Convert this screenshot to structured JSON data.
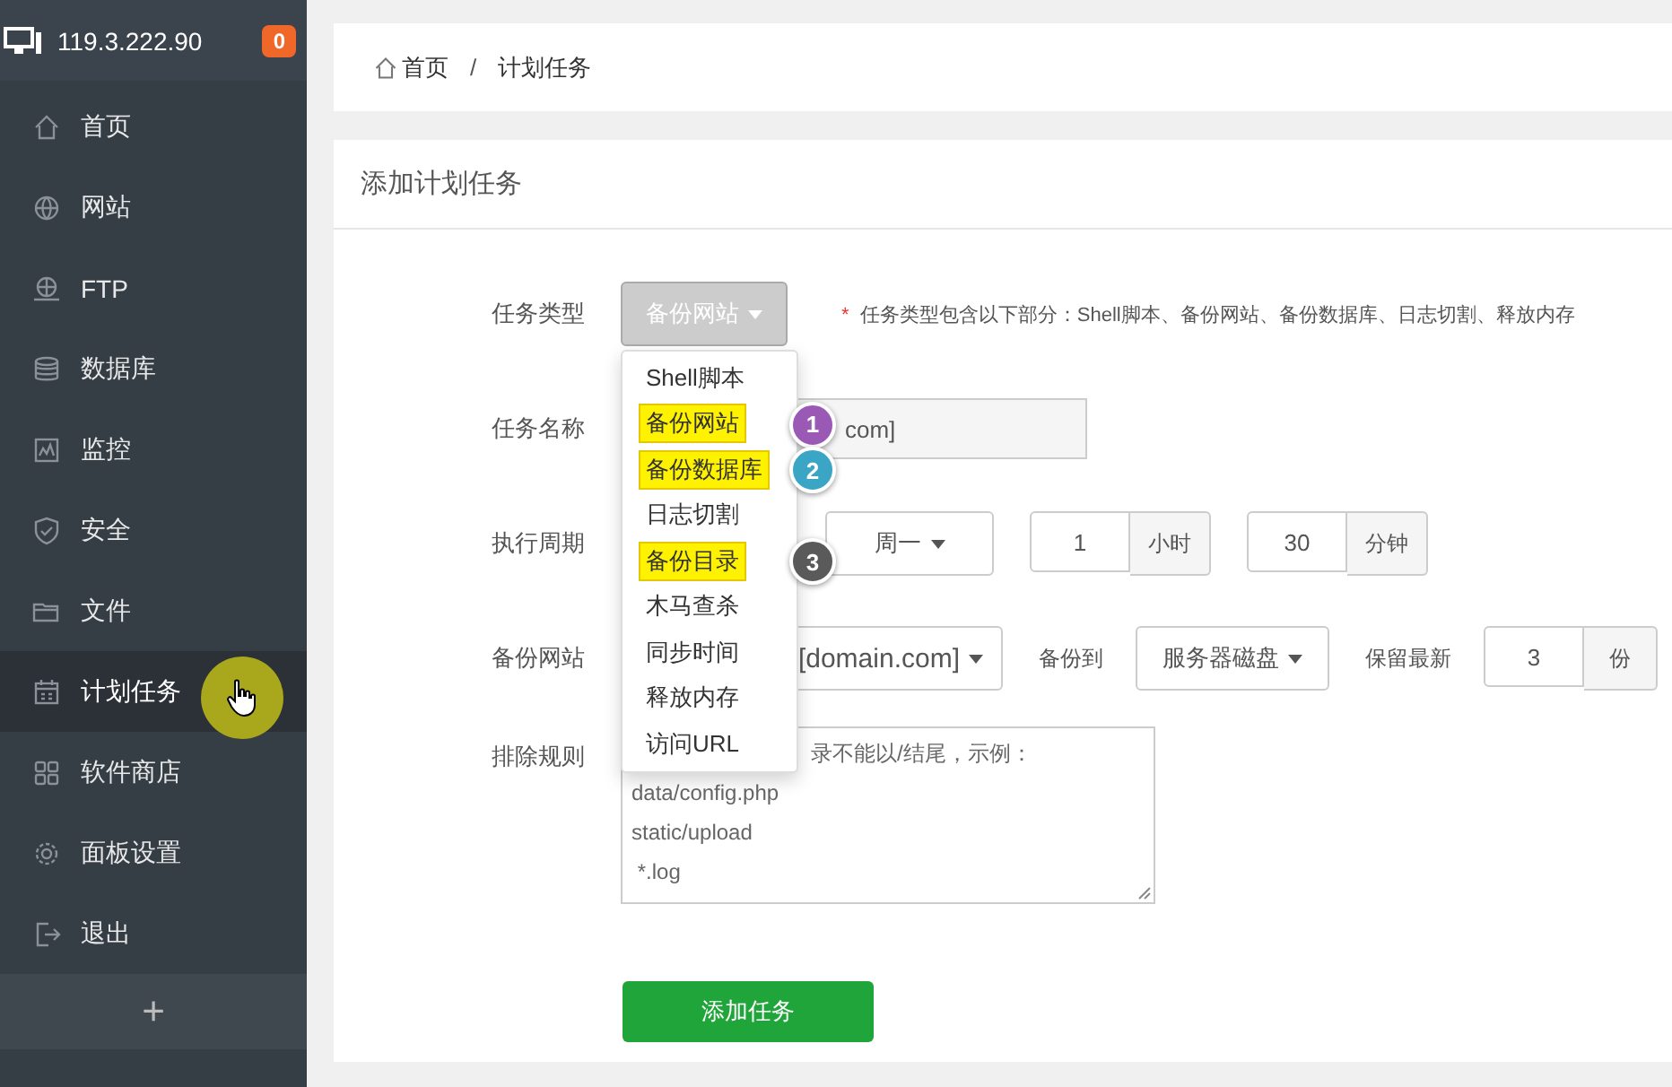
{
  "sidebar": {
    "host": "119.3.222.90",
    "badge": "0",
    "items": [
      {
        "label": "首页",
        "selected": false
      },
      {
        "label": "网站",
        "selected": false
      },
      {
        "label": "FTP",
        "selected": false
      },
      {
        "label": "数据库",
        "selected": false
      },
      {
        "label": "监控",
        "selected": false
      },
      {
        "label": "安全",
        "selected": false
      },
      {
        "label": "文件",
        "selected": false
      },
      {
        "label": "计划任务",
        "selected": true
      },
      {
        "label": "软件商店",
        "selected": false
      },
      {
        "label": "面板设置",
        "selected": false
      },
      {
        "label": "退出",
        "selected": false
      }
    ],
    "add_button": "+"
  },
  "breadcrumb": {
    "items": [
      "首页",
      "计划任务"
    ],
    "separator": "/"
  },
  "panel": {
    "title": "添加计划任务",
    "task_type": {
      "label": "任务类型",
      "value": "备份网站",
      "expanded": true,
      "note_mark": "*",
      "note": "任务类型包含以下部分：Shell脚本、备份网站、备份数据库、日志切割、释放内存",
      "options": [
        {
          "label": "Shell脚本",
          "highlighted": false
        },
        {
          "label": "备份网站",
          "highlighted": true,
          "step": "1",
          "color": "#9b59b6"
        },
        {
          "label": "备份数据库",
          "highlighted": true,
          "step": "2",
          "color": "#3ba5c5"
        },
        {
          "label": "日志切割",
          "highlighted": false
        },
        {
          "label": "备份目录",
          "highlighted": true,
          "step": "3",
          "color": "#5a5a5a"
        },
        {
          "label": "木马查杀",
          "highlighted": false
        },
        {
          "label": "同步时间",
          "highlighted": false
        },
        {
          "label": "释放内存",
          "highlighted": false
        },
        {
          "label": "访问URL",
          "highlighted": false
        }
      ]
    },
    "task_name": {
      "label": "任务名称",
      "value": "com]"
    },
    "cycle": {
      "label": "执行周期",
      "weekday": "周一",
      "hour": "1",
      "hour_unit": "小时",
      "minute": "30",
      "minute_unit": "分钟"
    },
    "backup": {
      "label": "备份网站",
      "site": "[domain.com]",
      "to_label": "备份到",
      "target": "服务器磁盘",
      "keep_label": "保留最新",
      "keep": "3",
      "keep_unit": "份"
    },
    "exclude": {
      "label": "排除规则",
      "placeholder": "录不能以/结尾，示例：\ndata/config.php\nstatic/upload\n *.log"
    },
    "submit": "添加任务"
  }
}
